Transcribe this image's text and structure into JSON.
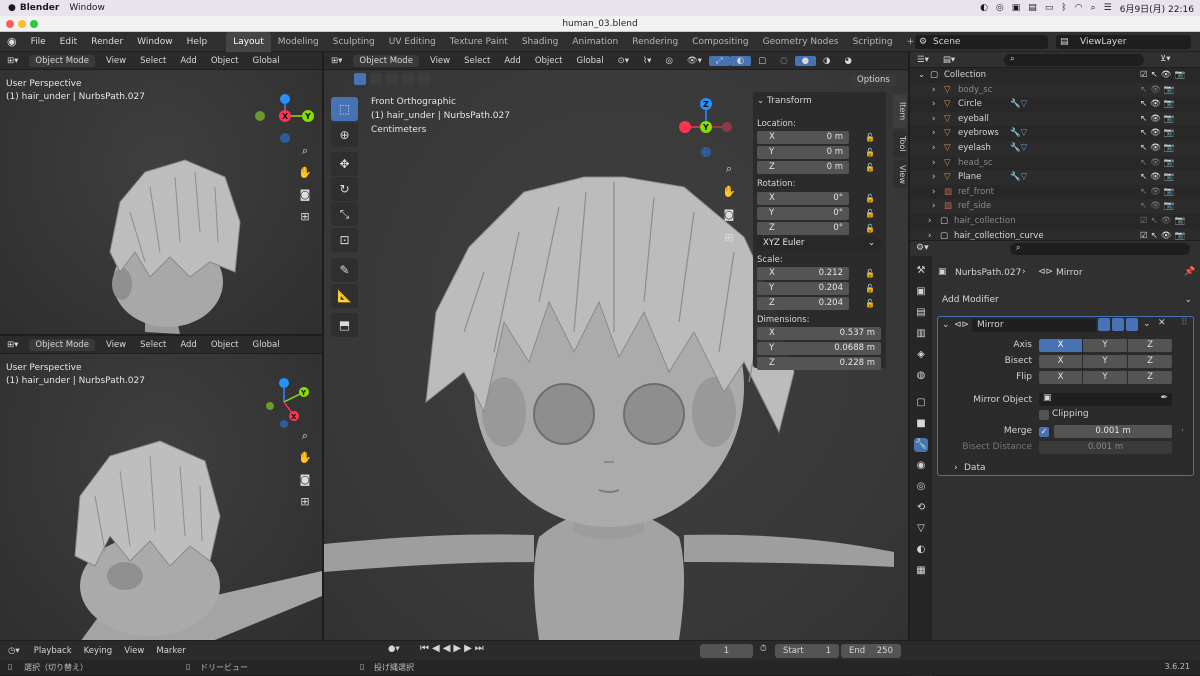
{
  "macbar": {
    "app": "Blender",
    "menu": "Window",
    "date": "6月9日(月) 22:16"
  },
  "window": {
    "title": "human_03.blend"
  },
  "topbar": {
    "menus": [
      "File",
      "Edit",
      "Render",
      "Window",
      "Help"
    ],
    "workspaces": [
      "Layout",
      "Modeling",
      "Sculpting",
      "UV Editing",
      "Texture Paint",
      "Shading",
      "Animation",
      "Rendering",
      "Compositing",
      "Geometry Nodes",
      "Scripting"
    ],
    "add": "+",
    "scene": "Scene",
    "viewlayer": "ViewLayer"
  },
  "vp_common": {
    "mode": "Object Mode",
    "view": "View",
    "select": "Select",
    "add": "Add",
    "object": "Object",
    "orient": "Global",
    "options": "Options"
  },
  "vp1": {
    "line1": "User Perspective",
    "line2": "(1) hair_under | NurbsPath.027"
  },
  "vp2": {
    "line1": "User Perspective",
    "line2": "(1) hair_under | NurbsPath.027"
  },
  "vp3": {
    "line1": "Front Orthographic",
    "line2": "(1) hair_under | NurbsPath.027",
    "line3": "Centimeters"
  },
  "gizmo": {
    "x": "X",
    "y": "Y",
    "z": "Z"
  },
  "npanel": {
    "title": "Transform",
    "location": "Location:",
    "rotation": "Rotation:",
    "scale": "Scale:",
    "dimensions": "Dimensions:",
    "loc": [
      {
        "k": "X",
        "v": "0 m"
      },
      {
        "k": "Y",
        "v": "0 m"
      },
      {
        "k": "Z",
        "v": "0 m"
      }
    ],
    "rot": [
      {
        "k": "X",
        "v": "0°"
      },
      {
        "k": "Y",
        "v": "0°"
      },
      {
        "k": "Z",
        "v": "0°"
      }
    ],
    "rotmode": "XYZ Euler",
    "scl": [
      {
        "k": "X",
        "v": "0.212"
      },
      {
        "k": "Y",
        "v": "0.204"
      },
      {
        "k": "Z",
        "v": "0.204"
      }
    ],
    "dim": [
      {
        "k": "X",
        "v": "0.537 m"
      },
      {
        "k": "Y",
        "v": "0.0688 m"
      },
      {
        "k": "Z",
        "v": "0.228 m"
      }
    ],
    "tabs": [
      "Item",
      "Tool",
      "View"
    ]
  },
  "outliner": {
    "rows": [
      {
        "name": "Collection",
        "type": "collection"
      },
      {
        "name": "body_sc",
        "type": "mesh",
        "dim": true
      },
      {
        "name": "Circle",
        "type": "mesh"
      },
      {
        "name": "eyeball",
        "type": "mesh"
      },
      {
        "name": "eyebrows",
        "type": "mesh"
      },
      {
        "name": "eyelash",
        "type": "mesh"
      },
      {
        "name": "head_sc",
        "type": "mesh",
        "dim": true
      },
      {
        "name": "Plane",
        "type": "mesh"
      },
      {
        "name": "ref_front",
        "type": "image",
        "dim": true
      },
      {
        "name": "ref_side",
        "type": "image",
        "dim": true
      },
      {
        "name": "hair_collection",
        "type": "collection",
        "dim": true
      },
      {
        "name": "hair_collection_curve",
        "type": "collection"
      }
    ]
  },
  "props": {
    "object": "NurbsPath.027",
    "modifier_ctx": "Mirror",
    "add_modifier": "Add Modifier",
    "mod_name": "Mirror",
    "axis": "Axis",
    "bisect": "Bisect",
    "flip": "Flip",
    "xyz": [
      "X",
      "Y",
      "Z"
    ],
    "mirror_object": "Mirror Object",
    "clipping": "Clipping",
    "merge": "Merge",
    "merge_val": "0.001 m",
    "bisect_distance": "Bisect Distance",
    "bisect_val": "0.001 m",
    "data": "Data"
  },
  "timeline": {
    "playback": "Playback",
    "keying": "Keying",
    "view": "View",
    "marker": "Marker",
    "frame": "1",
    "start_label": "Start",
    "start": "1",
    "end_label": "End",
    "end": "250"
  },
  "status": {
    "a": "選択（切り替え）",
    "b": "ドリービュー",
    "c": "投げ縄選択",
    "version": "3.6.21"
  },
  "colors": {
    "accent": "#4772b3",
    "x_axis": "#ff3352",
    "y_axis": "#8bdc00",
    "z_axis": "#2890ff",
    "mesh_icon": "#e09550"
  }
}
